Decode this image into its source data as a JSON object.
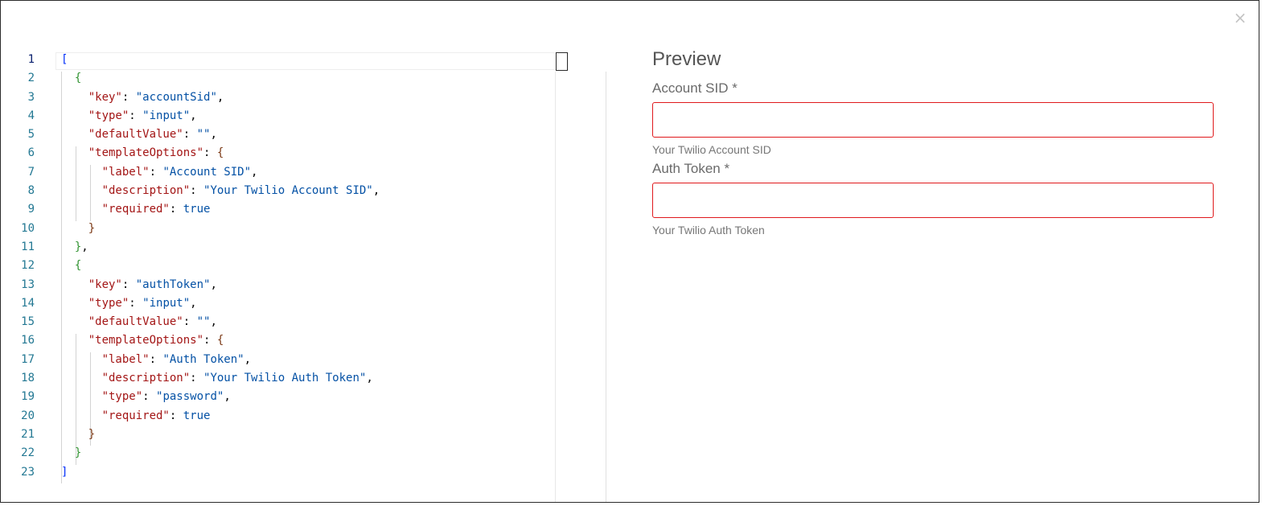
{
  "dialog": {
    "close_label": "×"
  },
  "editor": {
    "line_numbers": [
      "1",
      "2",
      "3",
      "4",
      "5",
      "6",
      "7",
      "8",
      "9",
      "10",
      "11",
      "12",
      "13",
      "14",
      "15",
      "16",
      "17",
      "18",
      "19",
      "20",
      "21",
      "22",
      "23"
    ],
    "lines": [
      [
        [
          "b0",
          "["
        ]
      ],
      [
        [
          "sp",
          "  "
        ],
        [
          "b1",
          "{"
        ]
      ],
      [
        [
          "sp",
          "    "
        ],
        [
          "key",
          "\"key\""
        ],
        [
          "p",
          ": "
        ],
        [
          "str",
          "\"accountSid\""
        ],
        [
          "p",
          ","
        ]
      ],
      [
        [
          "sp",
          "    "
        ],
        [
          "key",
          "\"type\""
        ],
        [
          "p",
          ": "
        ],
        [
          "str",
          "\"input\""
        ],
        [
          "p",
          ","
        ]
      ],
      [
        [
          "sp",
          "    "
        ],
        [
          "key",
          "\"defaultValue\""
        ],
        [
          "p",
          ": "
        ],
        [
          "str",
          "\"\""
        ],
        [
          "p",
          ","
        ]
      ],
      [
        [
          "sp",
          "    "
        ],
        [
          "key",
          "\"templateOptions\""
        ],
        [
          "p",
          ": "
        ],
        [
          "b2",
          "{"
        ]
      ],
      [
        [
          "sp",
          "      "
        ],
        [
          "key",
          "\"label\""
        ],
        [
          "p",
          ": "
        ],
        [
          "str",
          "\"Account SID\""
        ],
        [
          "p",
          ","
        ]
      ],
      [
        [
          "sp",
          "      "
        ],
        [
          "key",
          "\"description\""
        ],
        [
          "p",
          ": "
        ],
        [
          "str",
          "\"Your Twilio Account SID\""
        ],
        [
          "p",
          ","
        ]
      ],
      [
        [
          "sp",
          "      "
        ],
        [
          "key",
          "\"required\""
        ],
        [
          "p",
          ": "
        ],
        [
          "kw",
          "true"
        ]
      ],
      [
        [
          "sp",
          "    "
        ],
        [
          "b2",
          "}"
        ]
      ],
      [
        [
          "sp",
          "  "
        ],
        [
          "b1",
          "}"
        ],
        [
          "p",
          ","
        ]
      ],
      [
        [
          "sp",
          "  "
        ],
        [
          "b1",
          "{"
        ]
      ],
      [
        [
          "sp",
          "    "
        ],
        [
          "key",
          "\"key\""
        ],
        [
          "p",
          ": "
        ],
        [
          "str",
          "\"authToken\""
        ],
        [
          "p",
          ","
        ]
      ],
      [
        [
          "sp",
          "    "
        ],
        [
          "key",
          "\"type\""
        ],
        [
          "p",
          ": "
        ],
        [
          "str",
          "\"input\""
        ],
        [
          "p",
          ","
        ]
      ],
      [
        [
          "sp",
          "    "
        ],
        [
          "key",
          "\"defaultValue\""
        ],
        [
          "p",
          ": "
        ],
        [
          "str",
          "\"\""
        ],
        [
          "p",
          ","
        ]
      ],
      [
        [
          "sp",
          "    "
        ],
        [
          "key",
          "\"templateOptions\""
        ],
        [
          "p",
          ": "
        ],
        [
          "b2",
          "{"
        ]
      ],
      [
        [
          "sp",
          "      "
        ],
        [
          "key",
          "\"label\""
        ],
        [
          "p",
          ": "
        ],
        [
          "str",
          "\"Auth Token\""
        ],
        [
          "p",
          ","
        ]
      ],
      [
        [
          "sp",
          "      "
        ],
        [
          "key",
          "\"description\""
        ],
        [
          "p",
          ": "
        ],
        [
          "str",
          "\"Your Twilio Auth Token\""
        ],
        [
          "p",
          ","
        ]
      ],
      [
        [
          "sp",
          "      "
        ],
        [
          "key",
          "\"type\""
        ],
        [
          "p",
          ": "
        ],
        [
          "str",
          "\"password\""
        ],
        [
          "p",
          ","
        ]
      ],
      [
        [
          "sp",
          "      "
        ],
        [
          "key",
          "\"required\""
        ],
        [
          "p",
          ": "
        ],
        [
          "kw",
          "true"
        ]
      ],
      [
        [
          "sp",
          "    "
        ],
        [
          "b2",
          "}"
        ]
      ],
      [
        [
          "sp",
          "  "
        ],
        [
          "b1",
          "}"
        ]
      ],
      [
        [
          "b0",
          "]"
        ]
      ]
    ]
  },
  "preview": {
    "title": "Preview",
    "fields": [
      {
        "label": "Account SID *",
        "value": "",
        "help": "Your Twilio Account SID"
      },
      {
        "label": "Auth Token *",
        "value": "",
        "help": "Your Twilio Auth Token"
      }
    ]
  },
  "colors": {
    "error_border": "#e0191c",
    "key": "#a31515",
    "string": "#0451a5",
    "line_number": "#237893"
  }
}
